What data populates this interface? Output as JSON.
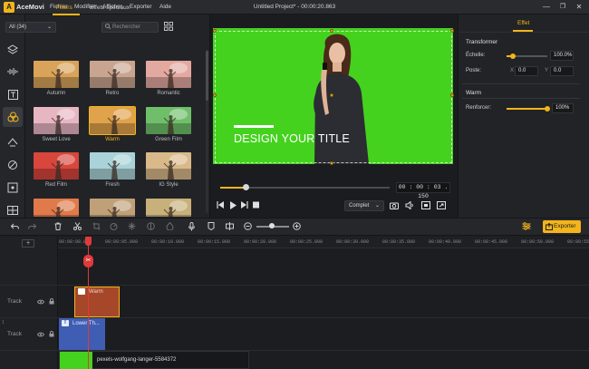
{
  "app": {
    "name": "AceMovi",
    "document_title": "Untitled Project* - 00:00:20.863"
  },
  "menu": [
    "Fichier",
    "Modifier",
    "Afficher",
    "Exporter",
    "Aide"
  ],
  "window_controls": [
    "—",
    "❐",
    "✕"
  ],
  "sidebar_icons": [
    "media-icon",
    "layers-icon",
    "audio-icon",
    "text-icon",
    "filters-icon",
    "transitions-icon",
    "overlays-icon",
    "elements-icon",
    "split-screen-icon"
  ],
  "filters_panel": {
    "tabs": [
      "Filters",
      "Effets spéciaux"
    ],
    "category": "All (34)",
    "search_placeholder": "Rechercher",
    "items": [
      {
        "label": "Autumn",
        "tint": "#d9a35a"
      },
      {
        "label": "Retro",
        "tint": "#c9a58f"
      },
      {
        "label": "Romantic",
        "tint": "#e3a9a0"
      },
      {
        "label": "Sweet Love",
        "tint": "#e7b6c3"
      },
      {
        "label": "Warm",
        "tint": "#e0a24a",
        "selected": true
      },
      {
        "label": "Green Film",
        "tint": "#6fbf6a"
      },
      {
        "label": "Red Film",
        "tint": "#d8463c"
      },
      {
        "label": "Fresh",
        "tint": "#a9d3d8"
      },
      {
        "label": "IG Style",
        "tint": "#d9b98a"
      },
      {
        "label": "",
        "tint": "#e07a4a"
      },
      {
        "label": "",
        "tint": "#bfa078"
      },
      {
        "label": "",
        "tint": "#c7b07a"
      }
    ]
  },
  "preview": {
    "overlay_title": "DESIGN YOUR TITLE",
    "timecode": "00 : 00 : 03 . 150",
    "progress": 0.15,
    "quality": "Complet",
    "green": "#45d21f"
  },
  "effect_panel": {
    "tab": "Effet",
    "transform_heading": "Transformer",
    "scale_label": "Échelle:",
    "scale_value": "100.0%",
    "scale_level": 0.15,
    "position_label": "Poste:",
    "x_label": "X",
    "x_value": "0.0",
    "y_label": "Y",
    "y_value": "0.0",
    "filter_heading": "Warm",
    "strength_label": "Renforcer:",
    "strength_value": "100%",
    "strength_level": 1.0
  },
  "toolbar": {
    "export_label": "Exporter",
    "icons": [
      "undo-icon",
      "redo-icon",
      "delete-icon",
      "cut-icon",
      "crop-icon",
      "speed-icon",
      "freeze-icon",
      "mask-icon",
      "mic-icon",
      "marker-icon",
      "split-icon",
      "zoom-out-icon",
      "zoom-in-icon",
      "fit-icon",
      "settings-icon"
    ],
    "accent": "#f3b51b"
  },
  "timeline": {
    "ruler": [
      "00:00:00.000",
      "00:00:05.000",
      "00:00:10.000",
      "00:00:15.000",
      "00:00:20.000",
      "00:00:25.000",
      "00:00:30.000",
      "00:00:35.000",
      "00:00:40.000",
      "00:00:45.000",
      "00:00:50.000",
      "00:00:55.000"
    ],
    "tracks": [
      {
        "label": "Track",
        "number": ""
      },
      {
        "label": "Track",
        "number": "1"
      },
      {
        "label": "",
        "number": ""
      }
    ],
    "clips": {
      "filter": "Warm",
      "text": "Lower Th...",
      "video": "pexels-wolfgang-langer-5584372"
    }
  }
}
